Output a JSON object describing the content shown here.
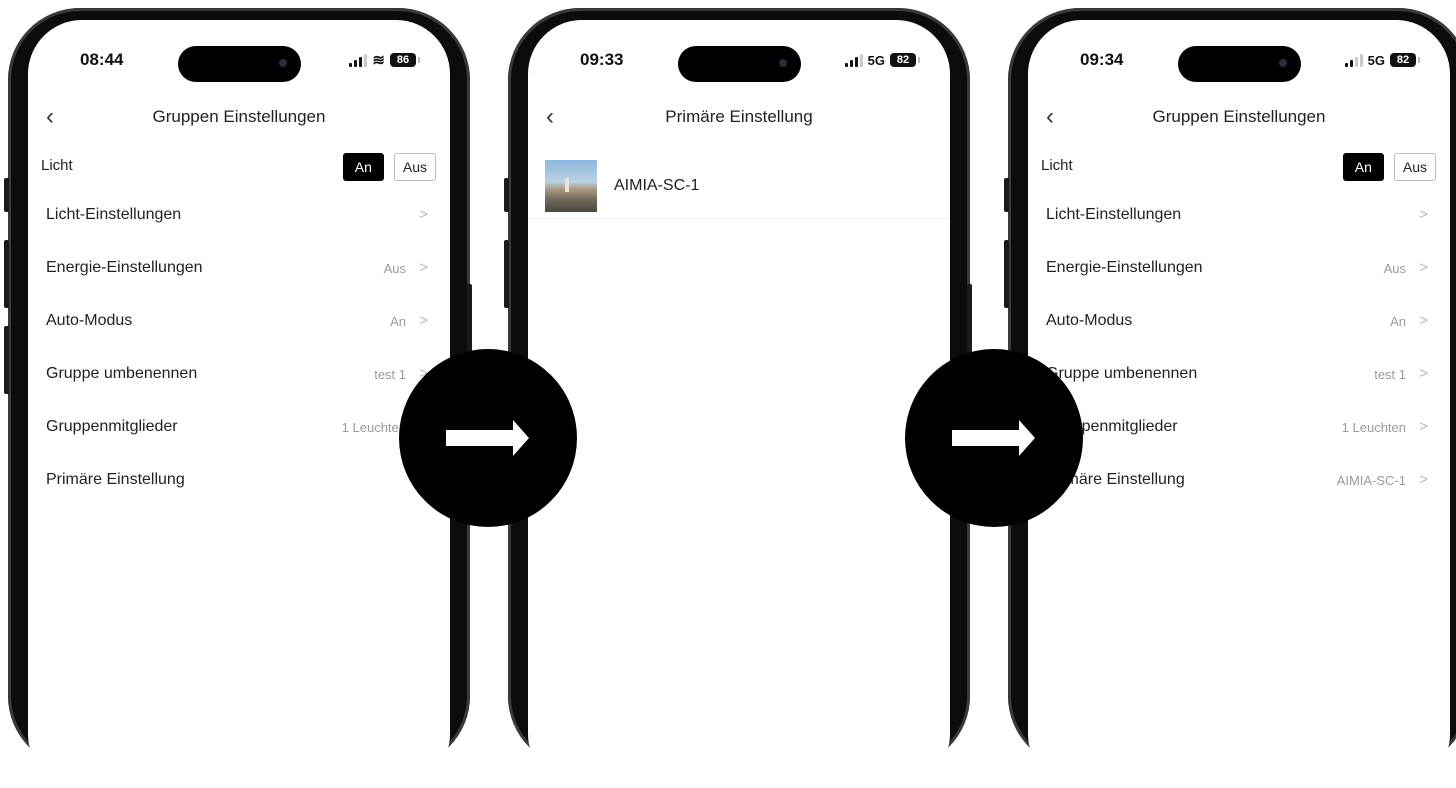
{
  "phones": [
    {
      "status": {
        "time": "08:44",
        "network": "",
        "battery": "86",
        "wifi": true
      },
      "header": {
        "title": "Gruppen Einstellungen"
      },
      "licht": {
        "label": "Licht",
        "on_label": "An",
        "off_label": "Aus"
      },
      "rows": [
        {
          "label": "Licht-Einstellungen",
          "value": ""
        },
        {
          "label": "Energie-Einstellungen",
          "value": "Aus"
        },
        {
          "label": "Auto-Modus",
          "value": "An"
        },
        {
          "label": "Gruppe umbenennen",
          "value": "test 1"
        },
        {
          "label": "Gruppenmitglieder",
          "value": "1 Leuchten"
        },
        {
          "label": "Primäre Einstellung",
          "value": ""
        }
      ]
    },
    {
      "status": {
        "time": "09:33",
        "network": "5G",
        "battery": "82",
        "wifi": false
      },
      "header": {
        "title": "Primäre Einstellung"
      },
      "device": {
        "name": "AIMIA-SC-1"
      }
    },
    {
      "status": {
        "time": "09:34",
        "network": "5G",
        "battery": "82",
        "wifi": false
      },
      "header": {
        "title": "Gruppen Einstellungen"
      },
      "licht": {
        "label": "Licht",
        "on_label": "An",
        "off_label": "Aus"
      },
      "rows": [
        {
          "label": "Licht-Einstellungen",
          "value": ""
        },
        {
          "label": "Energie-Einstellungen",
          "value": "Aus"
        },
        {
          "label": "Auto-Modus",
          "value": "An"
        },
        {
          "label": "Gruppe umbenennen",
          "value": "test 1"
        },
        {
          "label": "Gruppenmitglieder",
          "value": "1 Leuchten"
        },
        {
          "label": "Primäre Einstellung",
          "value": "AIMIA-SC-1"
        }
      ]
    }
  ],
  "icons": {
    "back": "chevron-left-icon",
    "row_chevron": "chevron-right-icon",
    "transition": "arrow-right-icon"
  },
  "colors": {
    "toggle_on_bg": "#000000",
    "value_text": "#9a9a9a",
    "transition_circle": "#000000"
  }
}
